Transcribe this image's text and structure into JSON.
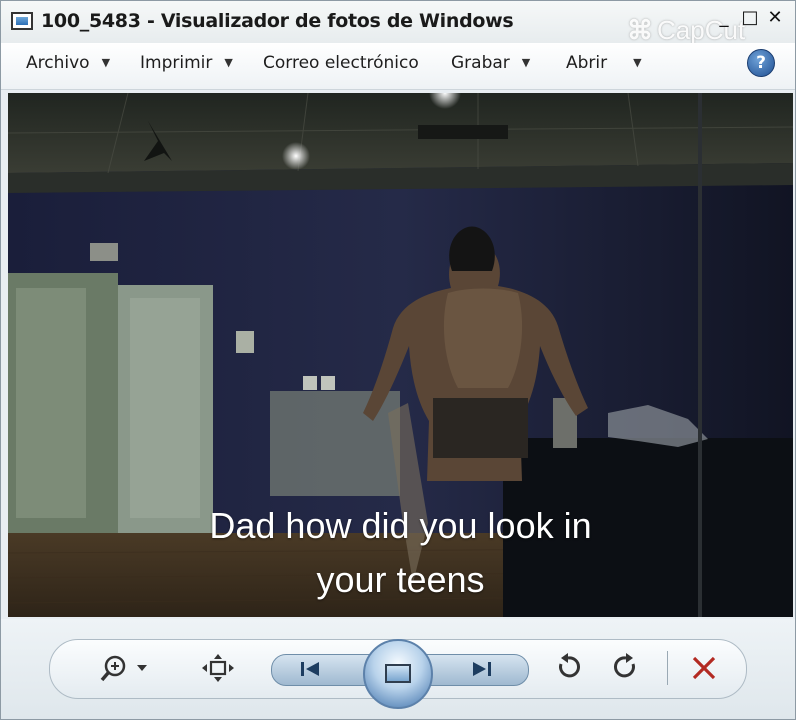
{
  "window": {
    "title": "100_5483 - Visualizador de fotos de Windows",
    "watermark": "CapCut",
    "controls": {
      "minimize": "_",
      "maximize": "□",
      "close": "✕"
    }
  },
  "menu": {
    "items": [
      {
        "label": "Archivo",
        "has_arrow": true
      },
      {
        "label": "Imprimir",
        "has_arrow": true
      },
      {
        "label": "Correo electrónico",
        "has_arrow": false
      },
      {
        "label": "Grabar",
        "has_arrow": true
      },
      {
        "label": "Abrir",
        "has_arrow": true
      }
    ],
    "help": "?"
  },
  "photo": {
    "caption_line1": "Dad how did you look in",
    "caption_line2": "your teens"
  },
  "toolbar": {
    "zoom": "zoom-icon",
    "fit": "fit-window-icon",
    "previous": "previous-icon",
    "slideshow": "slideshow-icon",
    "next": "next-icon",
    "rotate_left": "rotate-counterclockwise-icon",
    "rotate_right": "rotate-clockwise-icon",
    "delete": "delete-icon"
  },
  "colors": {
    "accent": "#2d6fb6",
    "delete": "#b32a22"
  }
}
